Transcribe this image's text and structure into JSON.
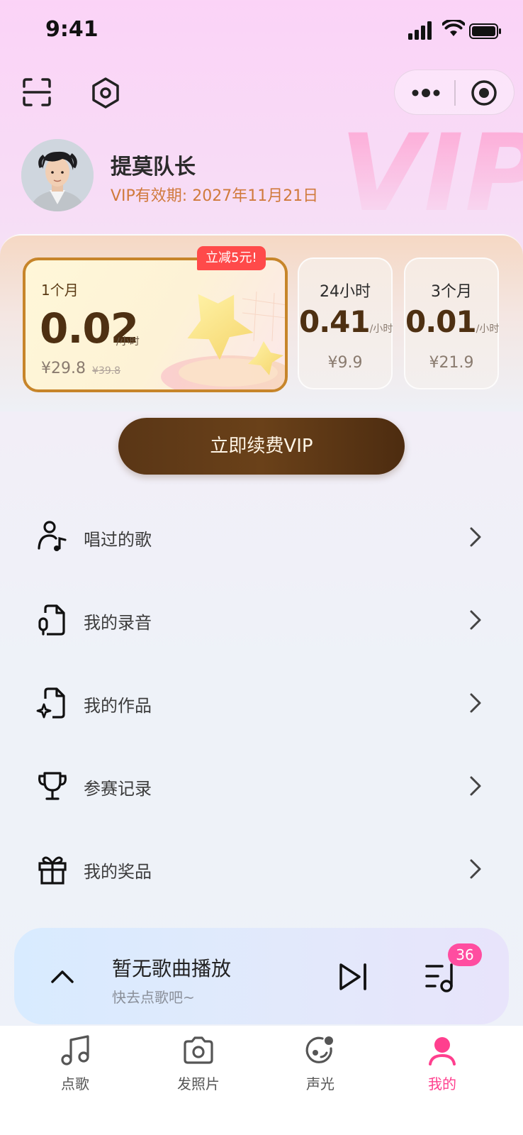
{
  "status_bar": {
    "time": "9:41"
  },
  "profile": {
    "name": "提莫队长",
    "expiry": "VIP有效期: 2027年11月21日",
    "watermark": "VIP"
  },
  "plans": {
    "promo_badge": "立减5元!",
    "featured": {
      "name": "1个月",
      "price": "0.02",
      "unit": "/小时",
      "sale_price": "¥29.8",
      "original_price": "¥39.8"
    },
    "option_24h": {
      "name": "24小时",
      "price": "0.41",
      "unit": "/小时",
      "sale_price": "¥9.9"
    },
    "option_3m": {
      "name": "3个月",
      "price": "0.01",
      "unit": "/小时",
      "sale_price": "¥21.9"
    }
  },
  "renew_button": "立即续费VIP",
  "menu": [
    {
      "label": "唱过的歌",
      "icon": "person-music-icon"
    },
    {
      "label": "我的录音",
      "icon": "recording-file-icon"
    },
    {
      "label": "我的作品",
      "icon": "works-file-icon"
    },
    {
      "label": "参赛记录",
      "icon": "trophy-icon"
    },
    {
      "label": "我的奖品",
      "icon": "gift-icon"
    }
  ],
  "player": {
    "title": "暂无歌曲播放",
    "subtitle": "快去点歌吧~",
    "queue_count": "36"
  },
  "tabs": [
    {
      "label": "点歌",
      "icon": "music-note-icon"
    },
    {
      "label": "发照片",
      "icon": "camera-icon"
    },
    {
      "label": "声光",
      "icon": "sound-light-icon"
    },
    {
      "label": "我的",
      "icon": "user-icon"
    }
  ],
  "colors": {
    "accent_pink": "#ff3f8e",
    "vip_brown": "#5a3616",
    "promo_red": "#ff4a4a",
    "expiry_orange": "#d07a3c",
    "featured_border": "#c7852a"
  }
}
